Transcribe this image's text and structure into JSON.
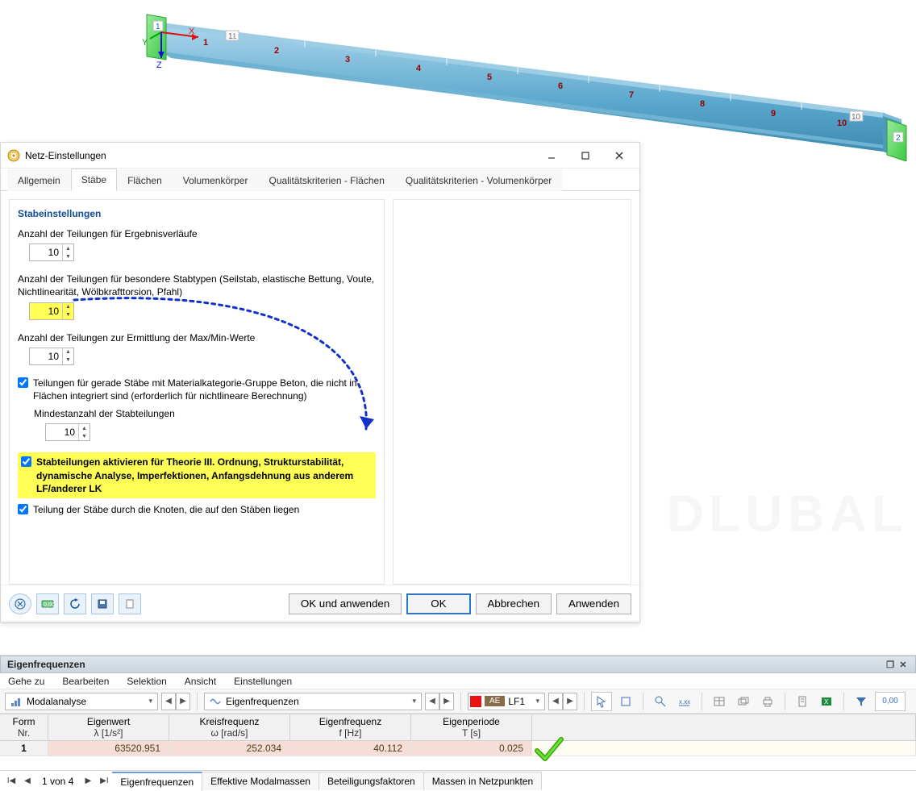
{
  "dialog": {
    "title": "Netz-Einstellungen",
    "tabs": [
      "Allgemein",
      "Stäbe",
      "Flächen",
      "Volumenkörper",
      "Qualitätskriterien - Flächen",
      "Qualitätskriterien - Volumenkörper"
    ],
    "active_tab_index": 1,
    "section_heading": "Stabeinstellungen",
    "field1_label": "Anzahl der Teilungen für Ergebnisverläufe",
    "field1_value": "10",
    "field2_label": "Anzahl der Teilungen für besondere Stabtypen (Seilstab, elastische Bettung, Voute, Nichtlinearität, Wölbkrafttorsion, Pfahl)",
    "field2_value": "10",
    "field3_label": "Anzahl der Teilungen zur Ermittlung der Max/Min-Werte",
    "field3_value": "10",
    "chk_concrete_label": "Teilungen für gerade Stäbe mit Materialkategorie-Gruppe Beton, die nicht in Flächen integriert sind (erforderlich für nichtlineare Berechnung)",
    "chk_concrete_sub_label": "Mindestanzahl der Stabteilungen",
    "chk_concrete_sub_value": "10",
    "chk_activate_label": "Stabteilungen aktivieren für Theorie III. Ordnung, Strukturstabilität, dynamische Analyse, Imperfektionen, Anfangsdehnung aus anderem LF/anderer LK",
    "chk_nodes_label": "Teilung der Stäbe durch die Knoten, die auf den Stäben liegen",
    "footer_buttons": {
      "ok_apply": "OK und anwenden",
      "ok": "OK",
      "cancel": "Abbrechen",
      "apply": "Anwenden"
    }
  },
  "results": {
    "panel_title": "Eigenfrequenzen",
    "menu": [
      "Gehe zu",
      "Bearbeiten",
      "Selektion",
      "Ansicht",
      "Einstellungen"
    ],
    "combo_analysis": "Modalanalyse",
    "combo_result": "Eigenfrequenzen",
    "lf_label": "LF1",
    "ae_label": "AE",
    "columns": [
      {
        "h1": "Form",
        "h2": "Nr."
      },
      {
        "h1": "Eigenwert",
        "h2": "λ [1/s²]"
      },
      {
        "h1": "Kreisfrequenz",
        "h2": "ω [rad/s]"
      },
      {
        "h1": "Eigenfrequenz",
        "h2": "f [Hz]"
      },
      {
        "h1": "Eigenperiode",
        "h2": "T [s]"
      }
    ],
    "row": {
      "nr": "1",
      "eigenwert": "63520.951",
      "kreisf": "252.034",
      "eigenf": "40.112",
      "periode": "0.025"
    },
    "pager_text": "1 von 4",
    "tabs": [
      "Eigenfrequenzen",
      "Effektive Modalmassen",
      "Beteiligungsfaktoren",
      "Massen in Netzpunkten"
    ],
    "active_tab_index": 0,
    "zero_label": "0,00"
  },
  "beam": {
    "axes": {
      "x": "X",
      "y": "Y",
      "z": "Z"
    },
    "end_nodes": [
      "1",
      "2"
    ],
    "seg_labels_top": [
      "11"
    ],
    "seg_labels_bottom": [
      "1",
      "2",
      "3",
      "4",
      "5",
      "6",
      "7",
      "8",
      "9",
      "10"
    ],
    "extra_right_label": "10"
  },
  "icons": {
    "spin_up": "▲",
    "spin_down": "▼"
  }
}
